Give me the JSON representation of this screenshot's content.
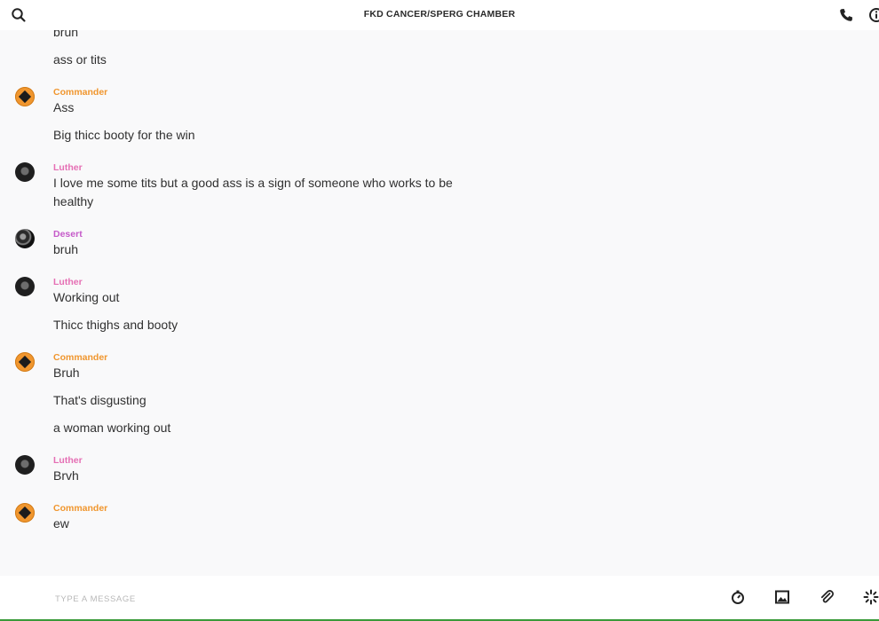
{
  "header": {
    "title": "FKD CANCER/SPERG CHAMBER"
  },
  "icons": {
    "search": "search-icon",
    "phone": "phone-icon",
    "info": "info-icon",
    "timer": "timer-icon",
    "image": "image-icon",
    "attach": "paperclip-icon",
    "spark": "sparkle-icon"
  },
  "colors": {
    "Commander": "#f0962e",
    "Luther": "#e56fb4",
    "Desert": "#c55ac9"
  },
  "messages": {
    "top": [
      "bruh",
      "ass or tits"
    ],
    "groups": [
      {
        "user": "Commander",
        "avatar": "cmd",
        "lines": [
          "Ass",
          "Big thicc booty for the win"
        ]
      },
      {
        "user": "Luther",
        "avatar": "dark",
        "lines": [
          "I love me some tits but a good ass is a sign of someone who works to be healthy"
        ]
      },
      {
        "user": "Desert",
        "avatar": "desert",
        "lines": [
          "bruh"
        ]
      },
      {
        "user": "Luther",
        "avatar": "dark",
        "lines": [
          "Working out",
          "Thicc thighs and booty"
        ]
      },
      {
        "user": "Commander",
        "avatar": "cmd",
        "lines": [
          "Bruh",
          "That's disgusting",
          "a woman working out"
        ]
      },
      {
        "user": "Luther",
        "avatar": "dark",
        "lines": [
          "Brvh"
        ]
      },
      {
        "user": "Commander",
        "avatar": "cmd",
        "lines": [
          "ew"
        ]
      }
    ]
  },
  "composer": {
    "placeholder": "TYPE A MESSAGE"
  }
}
